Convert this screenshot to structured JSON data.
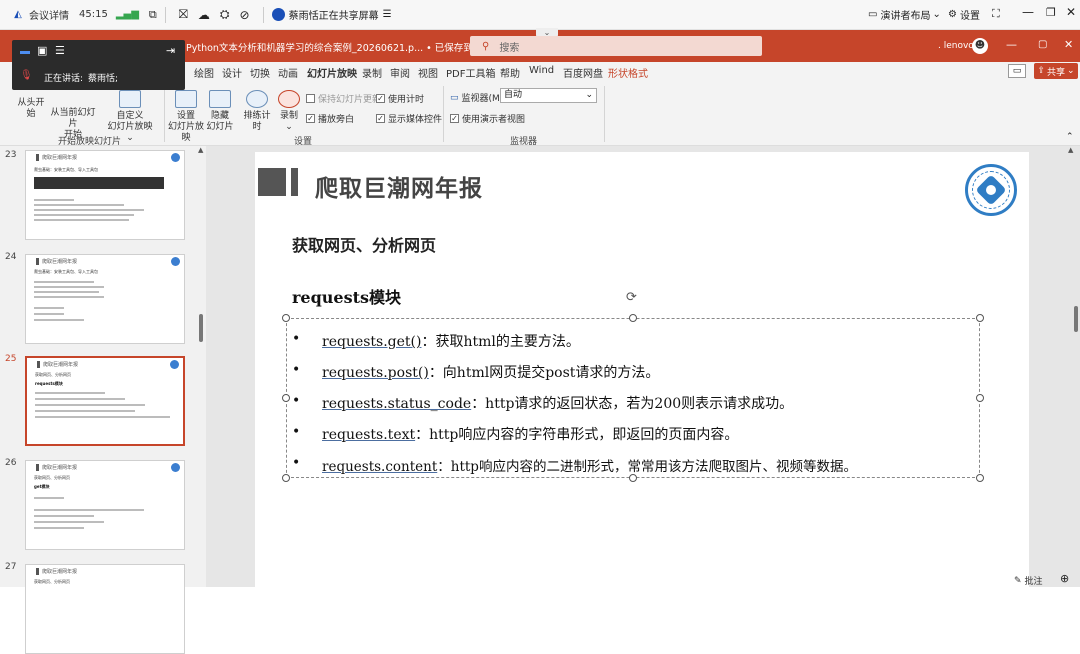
{
  "meeting": {
    "details": "会议详情",
    "timer": "45:15",
    "share_status": "蔡雨恬正在共享屏幕",
    "presenter_layout": "演讲者布局",
    "settings": "设置"
  },
  "window": {
    "file_title": "Python文本分析和机器学习的综合案例_20260621.p... • 已保存到这台电脑",
    "search_placeholder": "搜索",
    "user": ". lenovo",
    "share_button": "共享"
  },
  "floating_panel": {
    "speaking_label": "正在讲话:",
    "speaker": "蔡雨恬;"
  },
  "ribbon": {
    "tabs": [
      "绘图",
      "设计",
      "切换",
      "动画",
      "幻灯片放映",
      "录制",
      "审阅",
      "视图",
      "PDF工具箱",
      "帮助",
      "Wind",
      "百度网盘",
      "形状格式"
    ],
    "active_tab": "幻灯片放映",
    "buttons": {
      "from_start": "从头开始",
      "from_current_1": "从当前幻灯片",
      "from_current_2": "开始",
      "custom_1": "自定义",
      "custom_2": "幻灯片放映 ⌄",
      "setup_1": "设置",
      "setup_2": "幻灯片放映",
      "hide_1": "隐藏",
      "hide_2": "幻灯片",
      "rehearse": "排练计时",
      "record_1": "录制",
      "record_2": "⌄"
    },
    "checkboxes": {
      "keep_fresh": "保持幻灯片更新",
      "use_timing": "使用计时",
      "play_narration": "播放旁白",
      "show_media": "显示媒体控件",
      "use_presenter": "使用演示者视图"
    },
    "monitor_label": "监视器(M):",
    "monitor_value": "自动",
    "groups": {
      "start": "开始放映幻灯片",
      "setup": "设置",
      "monitors": "监视器"
    }
  },
  "thumbnails": {
    "numbers": [
      "23",
      "24",
      "25",
      "26",
      "27"
    ],
    "header": "爬取巨潮网年报",
    "t23_sub": "爬虫基础：安装工具包、导入工具包",
    "t24_sub": "爬虫基础：安装工具包、导入工具包",
    "t25_sub": "获取网页、分析网页",
    "t25_sub2": "requests模块",
    "t26_sub": "获取网页、分析网页",
    "t26_sub2": "get模块",
    "t27_sub": "获取网页、分析网页"
  },
  "slide": {
    "title": "爬取巨潮网年报",
    "subtitle": "获取网页、分析网页",
    "section": "requests模块",
    "bullets": [
      {
        "key": "requests.get()",
        "text": "：获取html的主要方法。"
      },
      {
        "key": "requests.post()",
        "text": "：向html网页提交post请求的方法。"
      },
      {
        "key": "requests.status_code",
        "text": "：http请求的返回状态，若为200则表示请求成功。"
      },
      {
        "key": "requests.text",
        "text": "：http响应内容的字符串形式，即返回的页面内容。"
      },
      {
        "key": "requests.content",
        "text": "：http响应内容的二进制形式，常常用该方法爬取图片、视频等数据。"
      }
    ]
  },
  "status": {
    "comments": "批注"
  },
  "colors": {
    "accent": "#c6452a",
    "selection": "#c6452a"
  }
}
